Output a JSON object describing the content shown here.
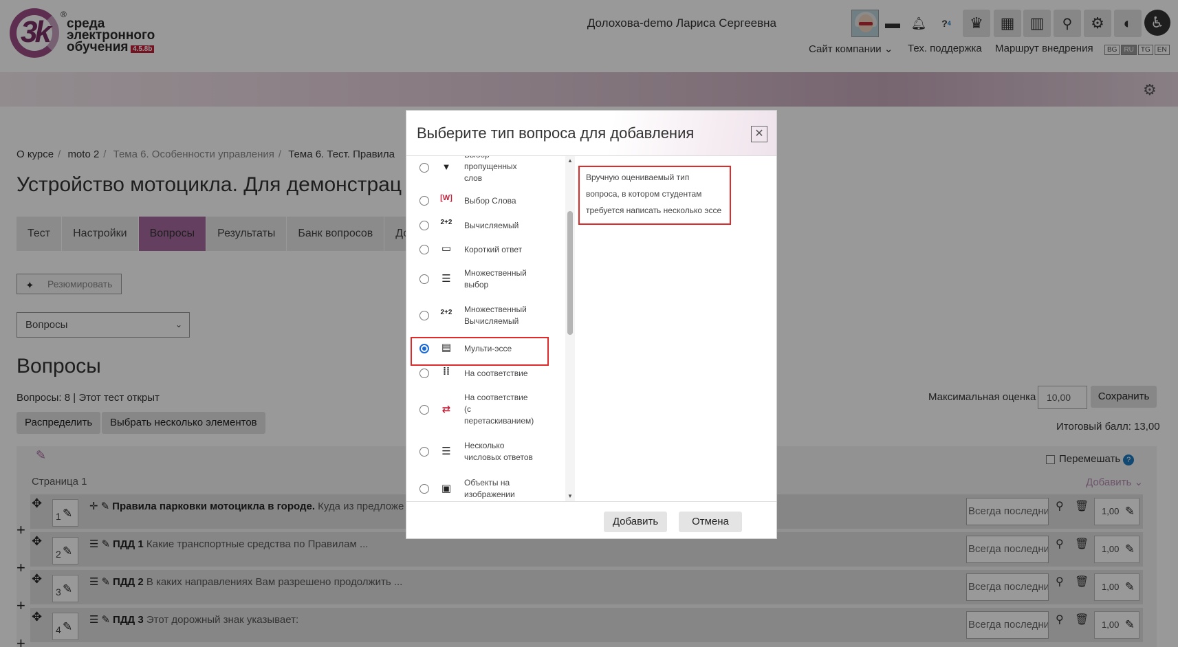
{
  "header": {
    "logo_text": [
      "среда",
      "электронного",
      "обучения"
    ],
    "logo_mark": "3k",
    "version": "4.5.8b",
    "user_name": "Долохова-demo Лариса Сергеевна",
    "msg_badge": "4",
    "nav": {
      "company": "Сайт компании",
      "support": "Тех. поддержка",
      "route": "Маршрут внедрения"
    },
    "langs": [
      "BG",
      "RU",
      "TG",
      "EN"
    ],
    "active_lang": "RU"
  },
  "breadcrumbs": [
    "О курсе",
    "moto 2",
    "Тема 6. Особенности управления",
    "Тема 6. Тест. Правила"
  ],
  "page_title": "Устройство мотоцикла. Для демонстрац",
  "tabs": [
    "Тест",
    "Настройки",
    "Вопросы",
    "Результаты",
    "Банк вопросов",
    "Допо"
  ],
  "active_tab": "Вопросы",
  "summarize_label": "Резюмировать",
  "select_value": "Вопросы",
  "section_title": "Вопросы",
  "questions_info": "Вопросы: 8 | Этот тест открыт",
  "buttons": {
    "distribute": "Распределить",
    "select_multiple": "Выбрать несколько элементов",
    "save": "Сохранить"
  },
  "max_grade_label": "Максимальная оценка",
  "max_grade_value": "10,00",
  "total_label": "Итоговый балл: 13,00",
  "shuffle_label": "Перемешать",
  "page_label": "Страница 1",
  "add_label": "Добавить",
  "questions": [
    {
      "num": "1",
      "title": "Правила парковки мотоцикла в городе.",
      "text": " Куда из предложе",
      "order": "Всегда последний",
      "grade": "1,00"
    },
    {
      "num": "2",
      "title": "ПДД 1",
      "text": " Какие транспортные средства по Правилам ...",
      "order": "Всегда последний",
      "grade": "1,00"
    },
    {
      "num": "3",
      "title": "ПДД 2",
      "text": " В каких направлениях Вам разрешено продолжить ...",
      "order": "Всегда последний",
      "grade": "1,00"
    },
    {
      "num": "4",
      "title": "ПДД 3",
      "text": " Этот дорожный знак указывает:",
      "order": "Всегда последний",
      "grade": "1,00"
    }
  ],
  "modal": {
    "title": "Выберите тип вопроса для добавления",
    "options": [
      {
        "label": "Выбор пропущенных слов",
        "icon": "▼"
      },
      {
        "label": "Выбор Слова",
        "icon": "[W]"
      },
      {
        "label": "Вычисляемый",
        "icon": "2+2"
      },
      {
        "label": "Короткий ответ",
        "icon": "▭"
      },
      {
        "label": "Множественный выбор",
        "icon": "☰"
      },
      {
        "label": "Множественный Вычисляемый",
        "icon": "2+2"
      },
      {
        "label": "Мульти-эссе",
        "icon": "▤",
        "selected": true
      },
      {
        "label": "На соответствие",
        "icon": "⁞⁞"
      },
      {
        "label": "На соответствие (с перетаскиванием)",
        "icon": "⇄"
      },
      {
        "label": "Несколько числовых ответов",
        "icon": "☰"
      },
      {
        "label": "Объекты на изображении",
        "icon": "▣"
      }
    ],
    "description": "Вручную оцениваемый тип вопроса, в котором студентам требуется написать несколько эссе",
    "add_button": "Добавить",
    "cancel_button": "Отмена"
  }
}
